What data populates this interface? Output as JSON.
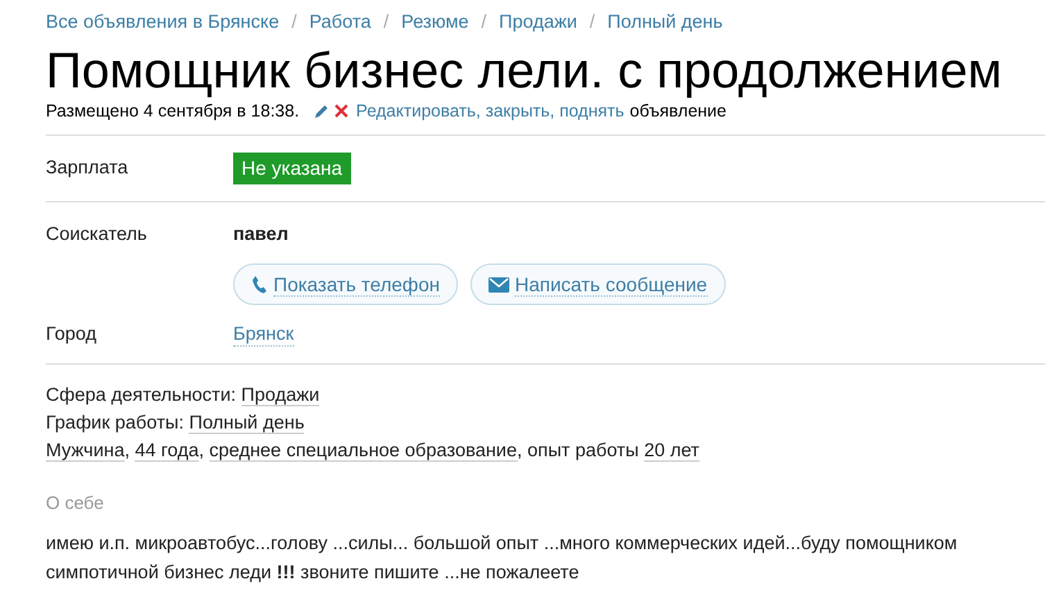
{
  "breadcrumbs": [
    {
      "kind": "link",
      "text": "Все объявления в Брянске"
    },
    {
      "kind": "separator",
      "text": "/"
    },
    {
      "kind": "link",
      "text": "Работа"
    },
    {
      "kind": "separator",
      "text": "/"
    },
    {
      "kind": "link",
      "text": "Резюме"
    },
    {
      "kind": "separator",
      "text": "/"
    },
    {
      "kind": "link",
      "text": "Продажи"
    },
    {
      "kind": "separator",
      "text": "/"
    },
    {
      "kind": "link",
      "text": "Полный день"
    }
  ],
  "title": "Помощник бизнес лели. с продолжением",
  "meta": {
    "posted": "Размещено 4 сентября в 18:38.",
    "actions": "Редактировать, закрыть, поднять",
    "suffix": "объявление"
  },
  "salary": {
    "label": "Зарплата",
    "value": "Не указана"
  },
  "applicant": {
    "label": "Соискатель",
    "name": "павел",
    "buttons": [
      {
        "kind": "phone",
        "label": "Показать телефон"
      },
      {
        "kind": "mail",
        "label": "Написать сообщение"
      }
    ]
  },
  "city": {
    "label": "Город",
    "value": "Брянск"
  },
  "details": [
    [
      {
        "kind": "text",
        "text": "Сфера деятельности: "
      },
      {
        "kind": "link",
        "text": "Продажи"
      }
    ],
    [
      {
        "kind": "text",
        "text": "График работы: "
      },
      {
        "kind": "link",
        "text": "Полный день"
      }
    ],
    [
      {
        "kind": "link",
        "text": "Мужчина"
      },
      {
        "kind": "text",
        "text": ", "
      },
      {
        "kind": "link",
        "text": "44 года"
      },
      {
        "kind": "text",
        "text": ", "
      },
      {
        "kind": "link",
        "text": "среднее специальное образование"
      },
      {
        "kind": "text",
        "text": ", опыт работы "
      },
      {
        "kind": "link",
        "text": "20 лет"
      }
    ]
  ],
  "about": {
    "heading": "О себе",
    "text": "имею и.п. микроавтобус...голову ...силы... большой опыт ...много коммерческих идей...буду помощником симпотичной бизнес леди **!!!** звоните пишите ...не пожалеете"
  }
}
